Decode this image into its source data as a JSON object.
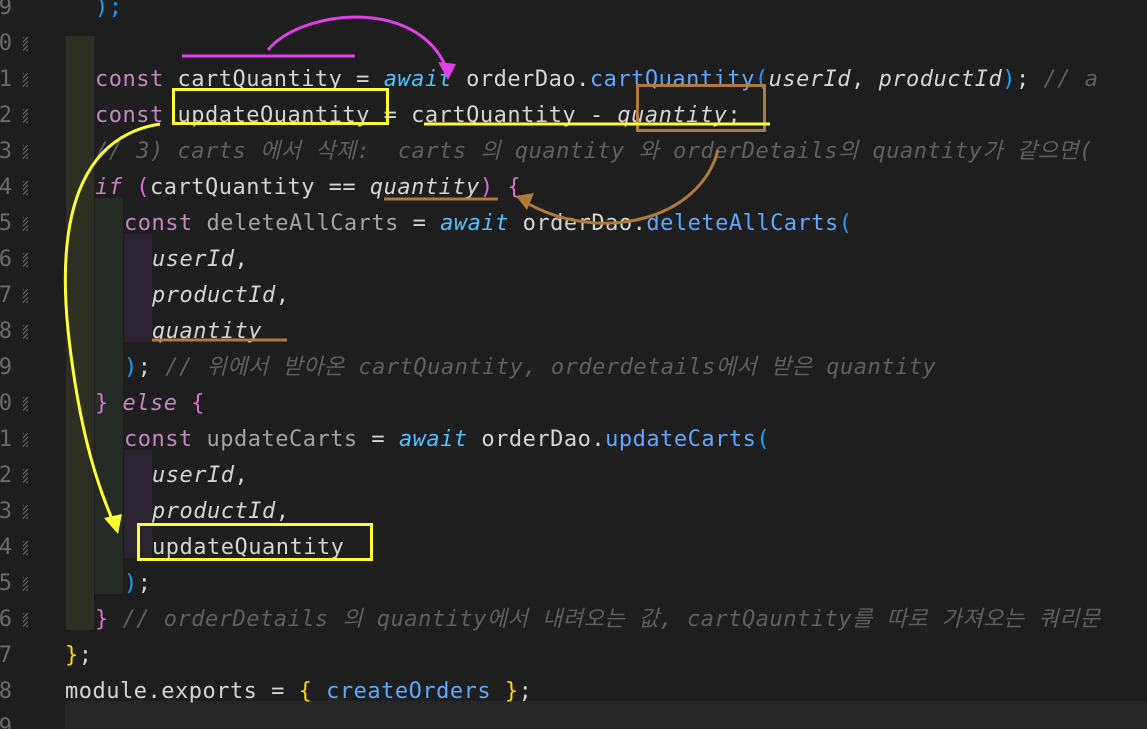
{
  "lines": [
    {
      "num": "9",
      "t": [
        {
          "c": "br3",
          "v": ");"
        }
      ]
    },
    {
      "num": "0",
      "t": []
    },
    {
      "num": "1",
      "t": [
        {
          "c": "kw",
          "v": "const "
        },
        {
          "c": "id",
          "v": "cartQuantity"
        },
        {
          "c": "id",
          "v": " = "
        },
        {
          "c": "aw",
          "v": "await"
        },
        {
          "c": "id",
          "v": " orderDao."
        },
        {
          "c": "fn",
          "v": "cartQuantity"
        },
        {
          "c": "br3",
          "v": "("
        },
        {
          "c": "par",
          "v": "userId"
        },
        {
          "c": "id",
          "v": ", "
        },
        {
          "c": "par",
          "v": "productId"
        },
        {
          "c": "br3",
          "v": ")"
        },
        {
          "c": "id",
          "v": "; "
        },
        {
          "c": "cm",
          "v": "// a"
        }
      ]
    },
    {
      "num": "2",
      "t": [
        {
          "c": "kw",
          "v": "const "
        },
        {
          "c": "id",
          "v": "updateQuantity"
        },
        {
          "c": "id",
          "v": " = "
        },
        {
          "c": "id",
          "v": "cartQuantity"
        },
        {
          "c": "id",
          "v": " - "
        },
        {
          "c": "par",
          "v": "quantity"
        },
        {
          "c": "id",
          "v": ";"
        }
      ]
    },
    {
      "num": "3",
      "t": [
        {
          "c": "cm",
          "v": "// 3) carts 에서 삭제:  carts 의 quantity 와 orderDetails의 quantity가 같으면("
        }
      ]
    },
    {
      "num": "4",
      "t": [
        {
          "c": "ctl",
          "v": "if"
        },
        {
          "c": "id",
          "v": " "
        },
        {
          "c": "br2",
          "v": "("
        },
        {
          "c": "id",
          "v": "cartQuantity == "
        },
        {
          "c": "par",
          "v": "quantity"
        },
        {
          "c": "br2",
          "v": ")"
        },
        {
          "c": "id",
          "v": " "
        },
        {
          "c": "br2",
          "v": "{"
        }
      ]
    },
    {
      "num": "5",
      "t": [
        {
          "c": "kw",
          "v": "const "
        },
        {
          "c": "dim",
          "v": "deleteAllCarts"
        },
        {
          "c": "id",
          "v": " = "
        },
        {
          "c": "aw",
          "v": "await"
        },
        {
          "c": "id",
          "v": " orderDao."
        },
        {
          "c": "fn",
          "v": "deleteAllCarts"
        },
        {
          "c": "br3",
          "v": "("
        }
      ]
    },
    {
      "num": "6",
      "t": [
        {
          "c": "par",
          "v": "userId"
        },
        {
          "c": "id",
          "v": ","
        }
      ]
    },
    {
      "num": "7",
      "t": [
        {
          "c": "par",
          "v": "productId"
        },
        {
          "c": "id",
          "v": ","
        }
      ]
    },
    {
      "num": "8",
      "t": [
        {
          "c": "par",
          "v": "quantity"
        }
      ]
    },
    {
      "num": "9",
      "t": [
        {
          "c": "br3",
          "v": ")"
        },
        {
          "c": "id",
          "v": "; "
        },
        {
          "c": "cm",
          "v": "// 위에서 받아온 cartQuantity, orderdetails에서 받은 quantity"
        }
      ]
    },
    {
      "num": "0",
      "t": [
        {
          "c": "br2",
          "v": "}"
        },
        {
          "c": "id",
          "v": " "
        },
        {
          "c": "ctl",
          "v": "else"
        },
        {
          "c": "id",
          "v": " "
        },
        {
          "c": "br2",
          "v": "{"
        }
      ]
    },
    {
      "num": "1",
      "t": [
        {
          "c": "kw",
          "v": "const "
        },
        {
          "c": "dim",
          "v": "updateCarts"
        },
        {
          "c": "id",
          "v": " = "
        },
        {
          "c": "aw",
          "v": "await"
        },
        {
          "c": "id",
          "v": " orderDao."
        },
        {
          "c": "fn",
          "v": "updateCarts"
        },
        {
          "c": "br3",
          "v": "("
        }
      ]
    },
    {
      "num": "2",
      "t": [
        {
          "c": "par",
          "v": "userId"
        },
        {
          "c": "id",
          "v": ","
        }
      ]
    },
    {
      "num": "3",
      "t": [
        {
          "c": "par",
          "v": "productId"
        },
        {
          "c": "id",
          "v": ","
        }
      ]
    },
    {
      "num": "4",
      "t": [
        {
          "c": "id",
          "v": "updateQuantity"
        }
      ]
    },
    {
      "num": "5",
      "t": [
        {
          "c": "br3",
          "v": ")"
        },
        {
          "c": "id",
          "v": ";"
        }
      ]
    },
    {
      "num": "6",
      "t": [
        {
          "c": "br2",
          "v": "}"
        },
        {
          "c": "id",
          "v": " "
        },
        {
          "c": "cm",
          "v": "// orderDetails 의 quantity에서 내려오는 값, cartQauntity를 따로 가져오는 쿼리문"
        }
      ]
    },
    {
      "num": "7",
      "t": [
        {
          "c": "br1",
          "v": "}"
        },
        {
          "c": "id",
          "v": ";"
        }
      ]
    },
    {
      "num": "8",
      "t": [
        {
          "c": "id",
          "v": "module.exports = "
        },
        {
          "c": "br1",
          "v": "{"
        },
        {
          "c": "id",
          "v": " "
        },
        {
          "c": "fn",
          "v": "createOrders"
        },
        {
          "c": "id",
          "v": " "
        },
        {
          "c": "br1",
          "v": "}"
        },
        {
          "c": "id",
          "v": ";"
        }
      ]
    },
    {
      "num": "9",
      "t": []
    }
  ],
  "colors": {
    "background": "#1e1e1e",
    "annotation_magenta": "#e040e8",
    "annotation_yellow": "#ffff33",
    "annotation_brown": "#b07a3a"
  }
}
